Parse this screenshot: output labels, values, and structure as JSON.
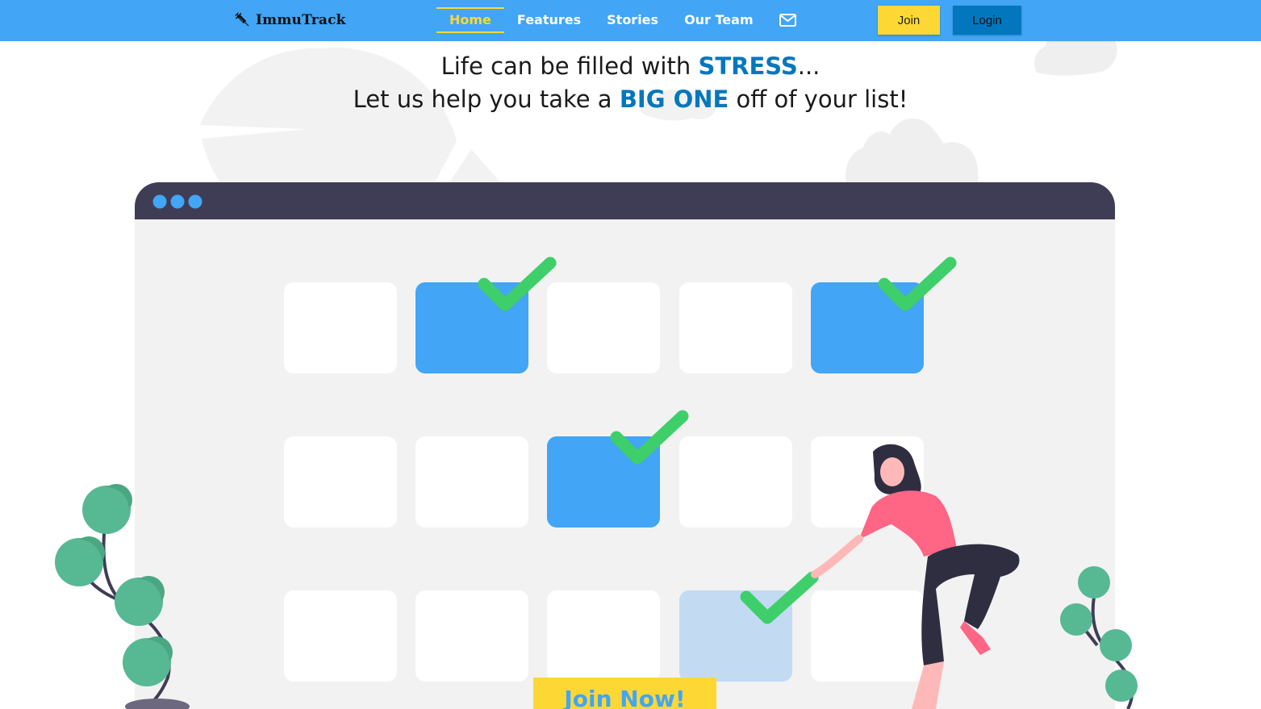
{
  "brand": {
    "name": "ImmuTrack",
    "icon": "syringe-icon"
  },
  "nav": {
    "items": [
      {
        "label": "Home",
        "active": true
      },
      {
        "label": "Features",
        "active": false
      },
      {
        "label": "Stories",
        "active": false
      },
      {
        "label": "Our Team",
        "active": false
      }
    ],
    "mail_icon": "envelope-icon"
  },
  "auth": {
    "join_label": "Join",
    "login_label": "Login"
  },
  "hero": {
    "line1_before": "Life can be filled with ",
    "line1_highlight": "STRESS",
    "line1_after": "...",
    "line2_before": "Let us help you take a ",
    "line2_highlight": "BIG ONE",
    "line2_after": " off of your list!"
  },
  "cta": {
    "label": "Join Now!"
  },
  "colors": {
    "navbar": "#42a5f5",
    "accent_yellow": "#fdd835",
    "highlight_blue": "#0277bd",
    "checkmark_green": "#3ecf6a",
    "calendar_header": "#3f3d56",
    "calendar_body": "#f2f2f2",
    "plant_green": "#57b894",
    "person_shirt": "#ff6584"
  }
}
